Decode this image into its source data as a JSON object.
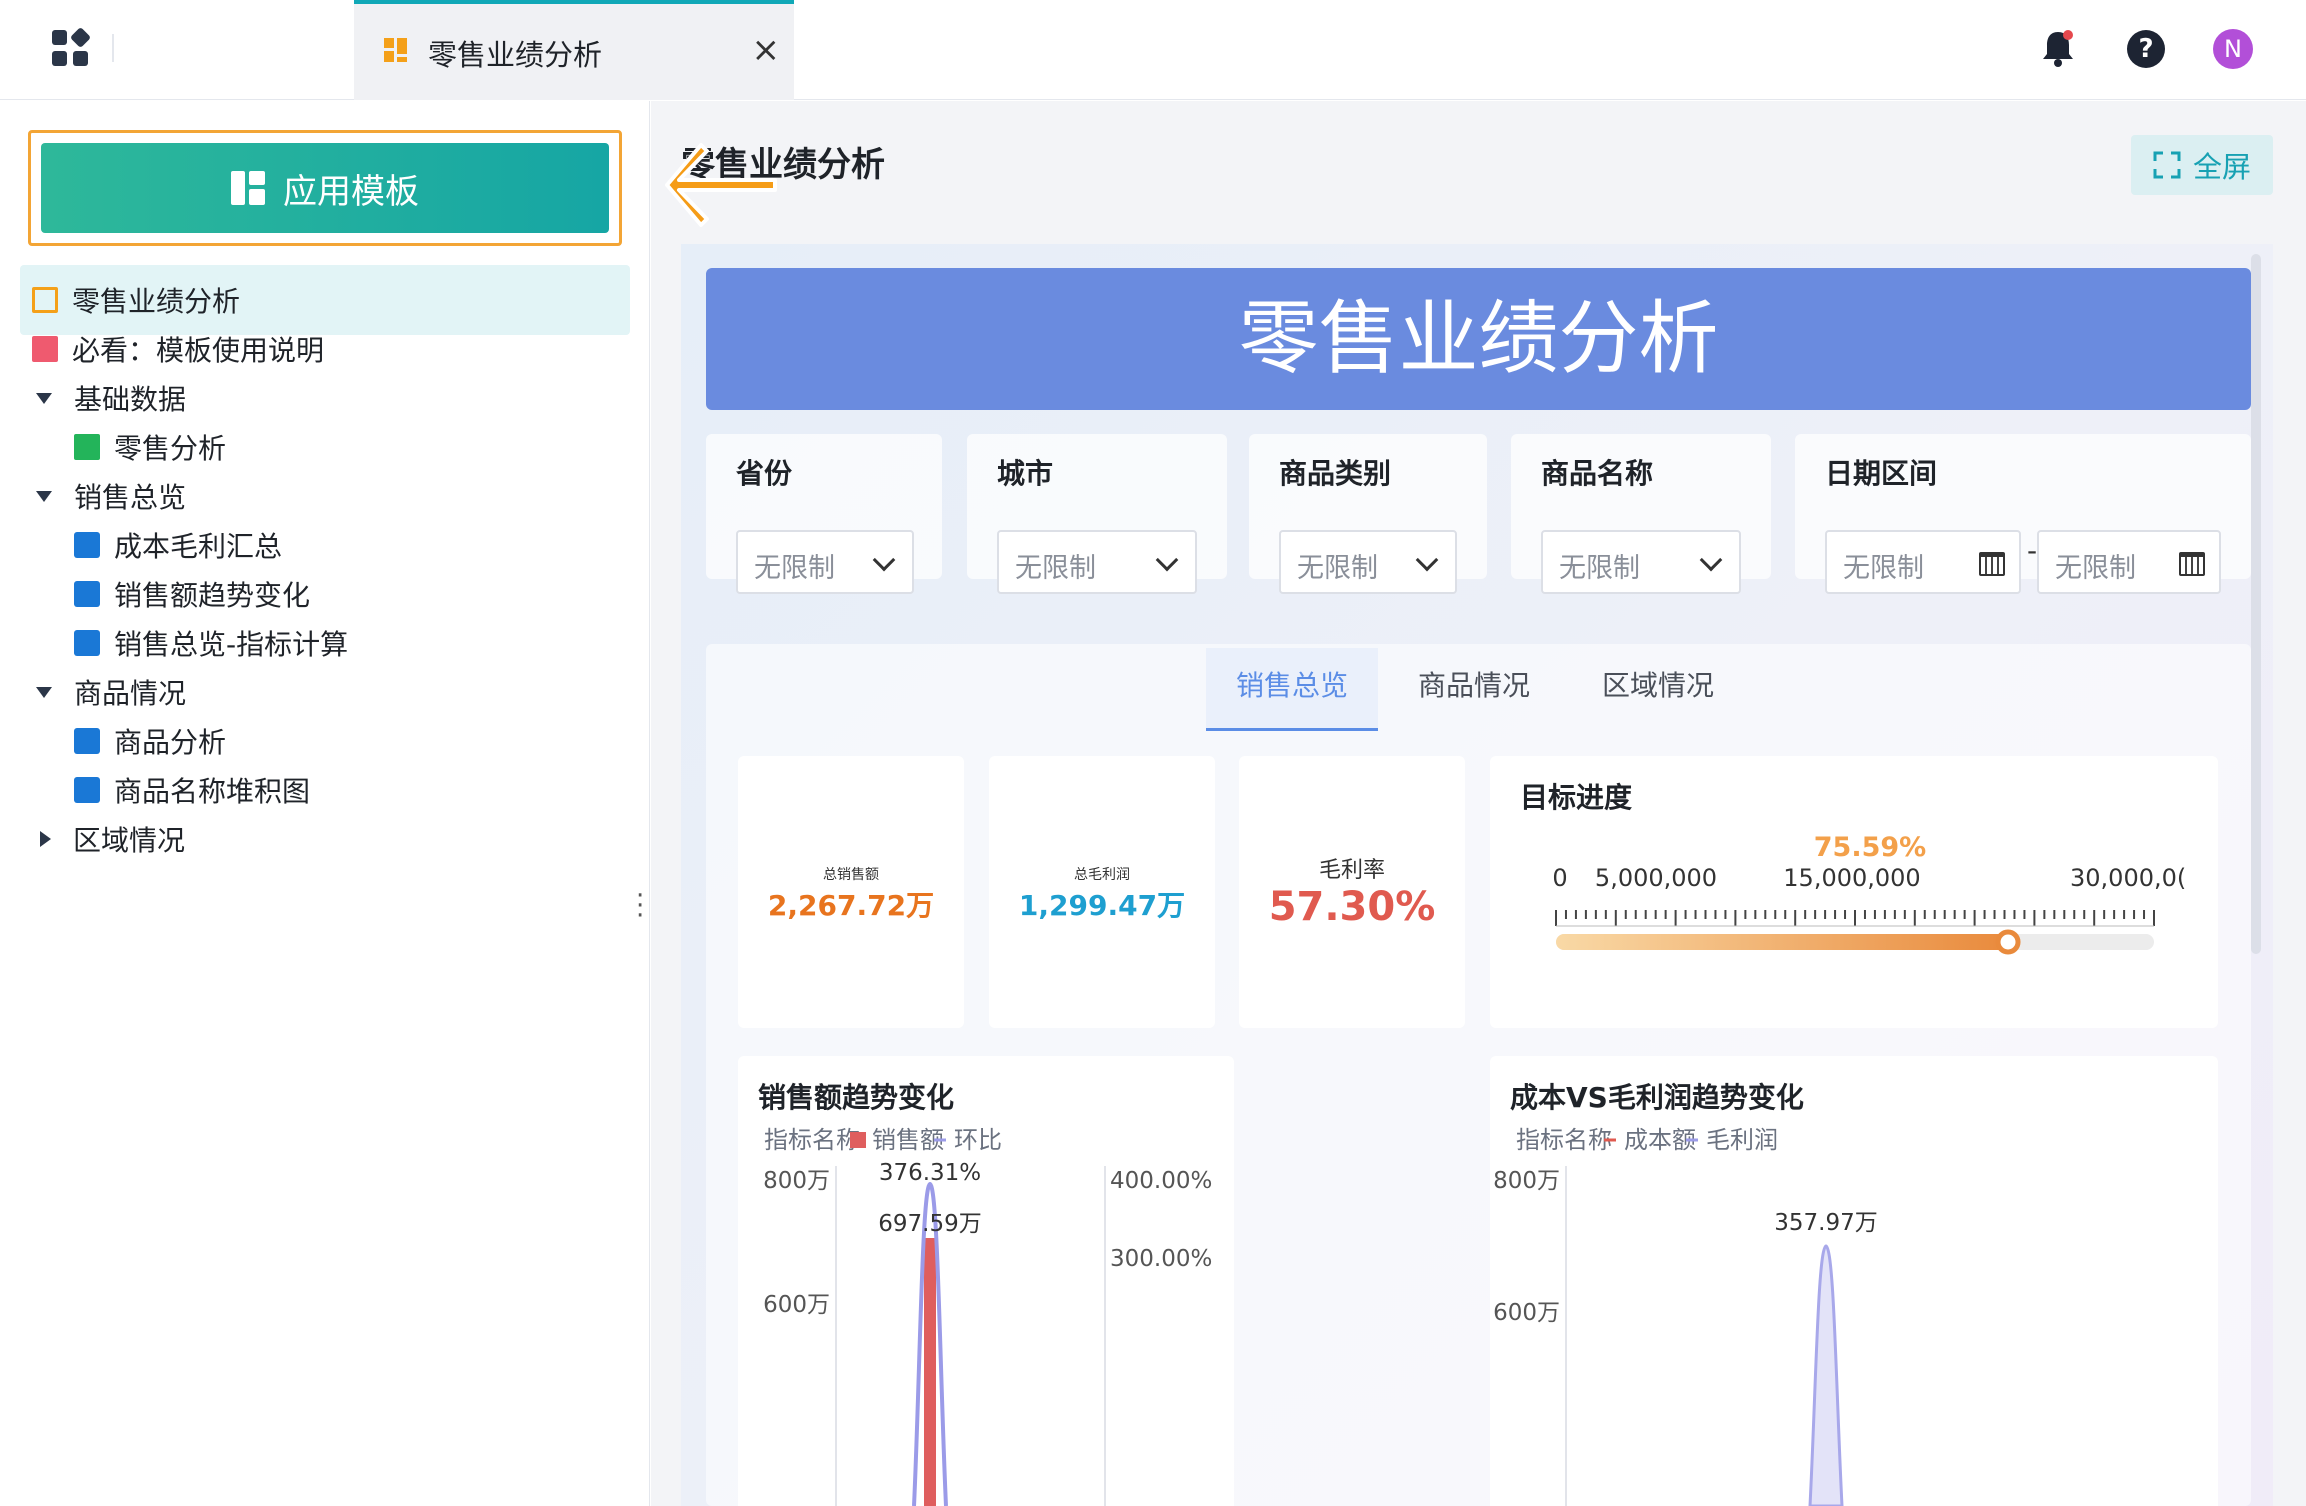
{
  "tab": {
    "title": "零售业绩分析",
    "close": "×"
  },
  "header": {
    "help": "?",
    "avatar_initial": "N"
  },
  "sidebar": {
    "template_button": "应用模板",
    "items": [
      {
        "label": "零售业绩分析"
      },
      {
        "label": "必看：模板使用说明"
      },
      {
        "label": "基础数据"
      },
      {
        "label": "零售分析"
      },
      {
        "label": "销售总览"
      },
      {
        "label": "成本毛利汇总"
      },
      {
        "label": "销售额趋势变化"
      },
      {
        "label": "销售总览-指标计算"
      },
      {
        "label": "商品情况"
      },
      {
        "label": "商品分析"
      },
      {
        "label": "商品名称堆积图"
      },
      {
        "label": "区域情况"
      }
    ]
  },
  "main": {
    "page_title": "零售业绩分析",
    "fullscreen": "全屏"
  },
  "dashboard": {
    "banner": "零售业绩分析",
    "filters": {
      "province": {
        "label": "省份",
        "value": "无限制"
      },
      "city": {
        "label": "城市",
        "value": "无限制"
      },
      "category": {
        "label": "商品类别",
        "value": "无限制"
      },
      "product": {
        "label": "商品名称",
        "value": "无限制"
      },
      "date": {
        "label": "日期区间",
        "start": "无限制",
        "sep": "-",
        "end": "无限制"
      }
    },
    "tabs": [
      "销售总览",
      "商品情况",
      "区域情况"
    ],
    "kpis": [
      {
        "label": "总销售额",
        "value": "2,267.72万",
        "color": "#e8741e"
      },
      {
        "label": "总毛利润",
        "value": "1,299.47万",
        "color": "#1e9fd0"
      },
      {
        "label": "毛利率",
        "value": "57.30%",
        "color": "#e05a4f"
      }
    ],
    "progress": {
      "title": "目标进度",
      "percent_label": "75.59%",
      "fraction": 0.7559,
      "scale_labels": [
        "0",
        "5,000,000",
        "15,000,000",
        "30,000,0("
      ]
    },
    "sales_chart": {
      "title": "销售额趋势变化",
      "legend_title": "指标名称",
      "legend": [
        "销售额",
        "环比"
      ],
      "y_left": [
        "800万",
        "600万"
      ],
      "y_right": [
        "400.00%",
        "300.00%"
      ],
      "labels": [
        "376.31%",
        "697.59万"
      ]
    },
    "profit_chart": {
      "title": "成本VS毛利润趋势变化",
      "legend_title": "指标名称",
      "legend": [
        "成本额",
        "毛利润"
      ],
      "y_left": [
        "800万",
        "600万"
      ],
      "labels": [
        "357.97万"
      ]
    }
  }
}
